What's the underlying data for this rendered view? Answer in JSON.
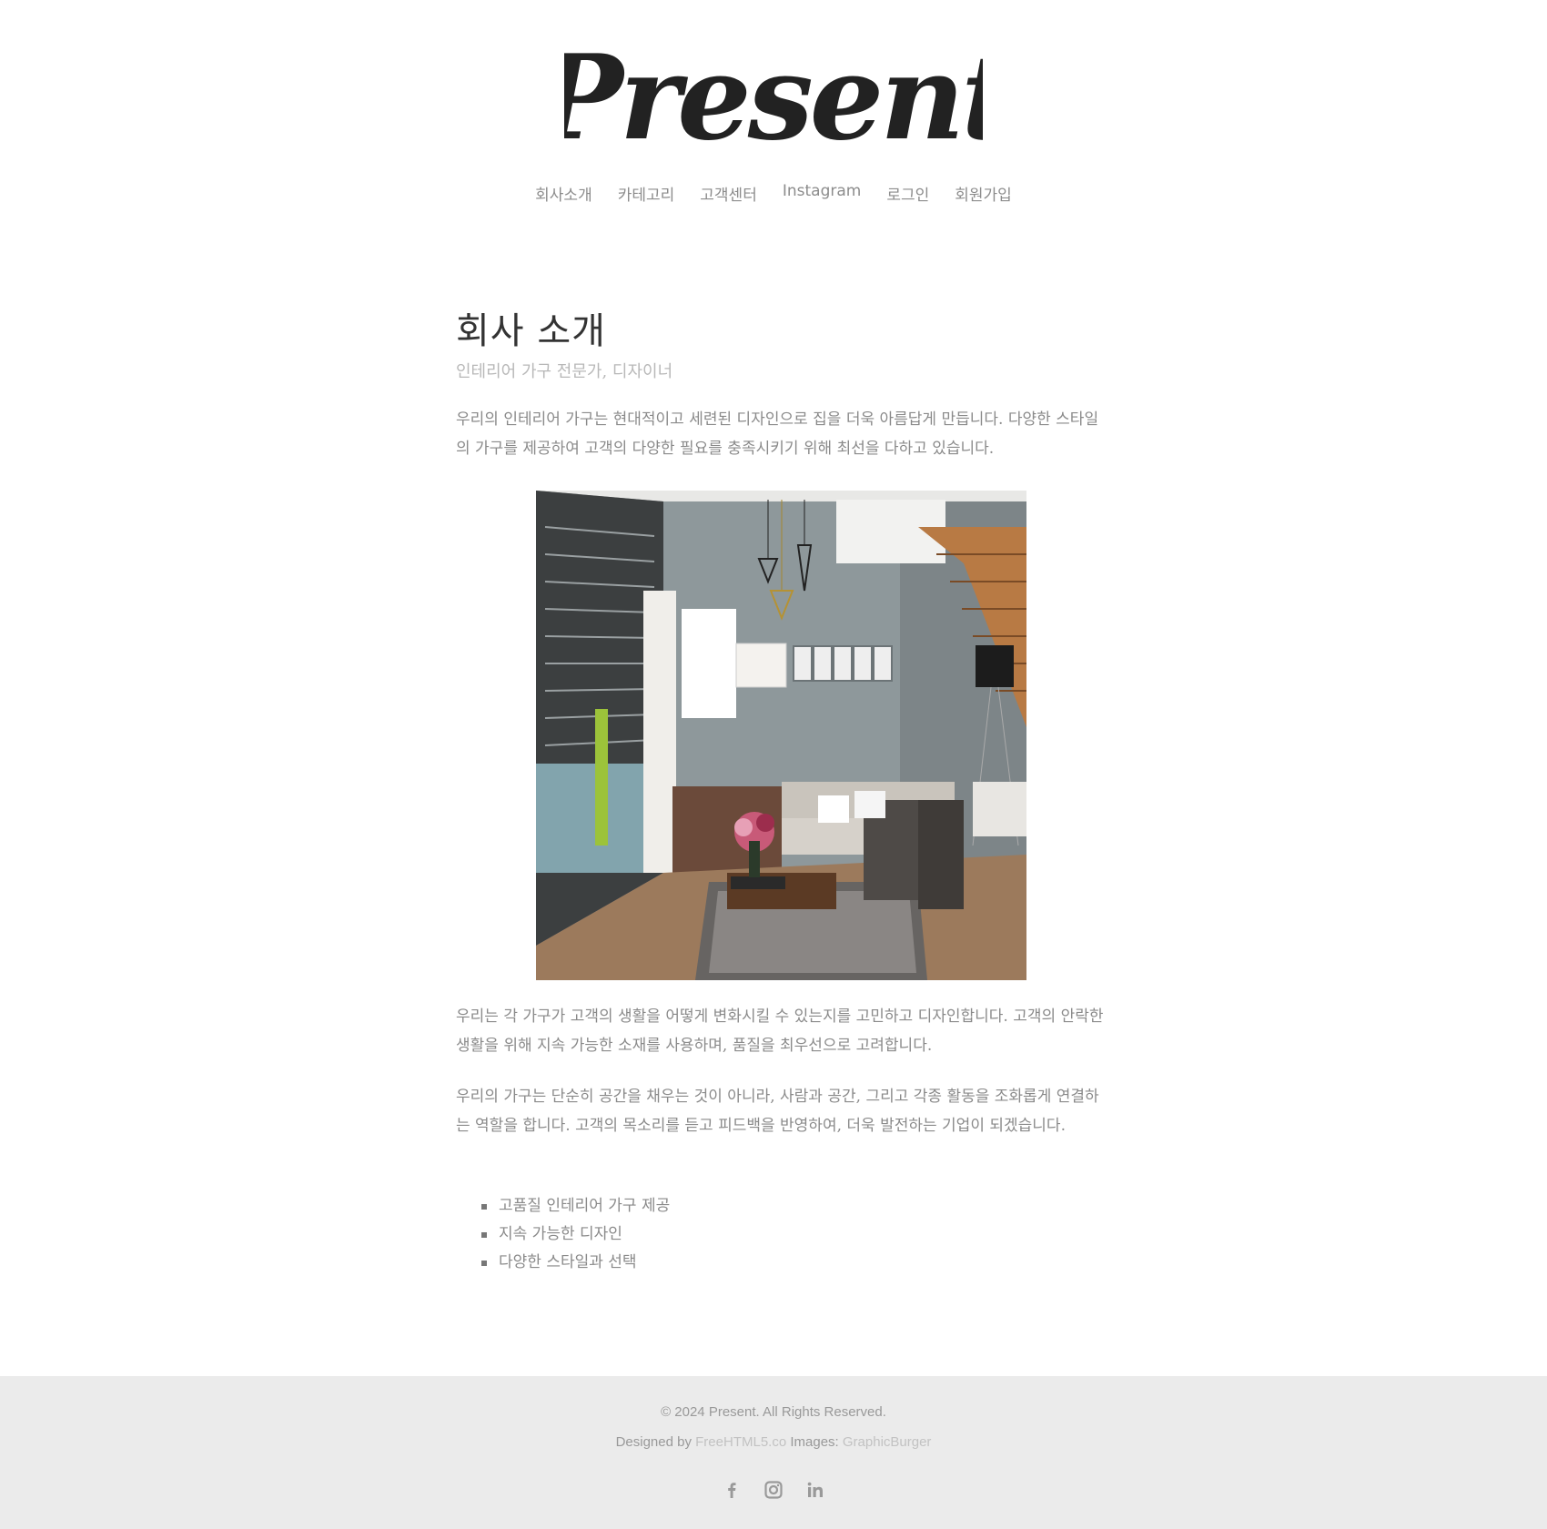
{
  "brand": {
    "logo_text": "Present"
  },
  "nav": {
    "items": [
      {
        "label": "회사소개"
      },
      {
        "label": "카테고리"
      },
      {
        "label": "고객센터"
      },
      {
        "label": "Instagram"
      },
      {
        "label": "로그인"
      },
      {
        "label": "회원가입"
      }
    ]
  },
  "page": {
    "title": "회사 소개",
    "subtitle": "인테리어 가구 전문가, 디자이너",
    "intro": "우리의 인테리어 가구는 현대적이고 세련된 디자인으로 집을 더욱 아름답게 만듭니다. 다양한 스타일의 가구를 제공하여 고객의 다양한 필요를 충족시키기 위해 최선을 다하고 있습니다.",
    "paragraph2": "우리는 각 가구가 고객의 생활을 어떻게 변화시킬 수 있는지를 고민하고 디자인합니다. 고객의 안락한 생활을 위해 지속 가능한 소재를 사용하며, 품질을 최우선으로 고려합니다.",
    "paragraph3": "우리의 가구는 단순히 공간을 채우는 것이 아니라, 사람과 공간, 그리고 각종 활동을 조화롭게 연결하는 역할을 합니다. 고객의 목소리를 듣고 피드백을 반영하여, 더욱 발전하는 기업이 되겠습니다.",
    "features": [
      "고품질 인테리어 가구 제공",
      "지속 가능한 디자인",
      "다양한 스타일과 선택"
    ]
  },
  "footer": {
    "copyright": "© 2024 Present. All Rights Reserved.",
    "designed_by_label": "Designed by",
    "designer_link": "FreeHTML5.co",
    "images_label": "Images:",
    "images_link": "GraphicBurger",
    "social": [
      "facebook-icon",
      "instagram-icon",
      "linkedin-icon"
    ]
  },
  "colors": {
    "footer_bg": "#ebebeb",
    "text": "#8a8a8a",
    "title": "#333333",
    "logo": "#222222"
  }
}
